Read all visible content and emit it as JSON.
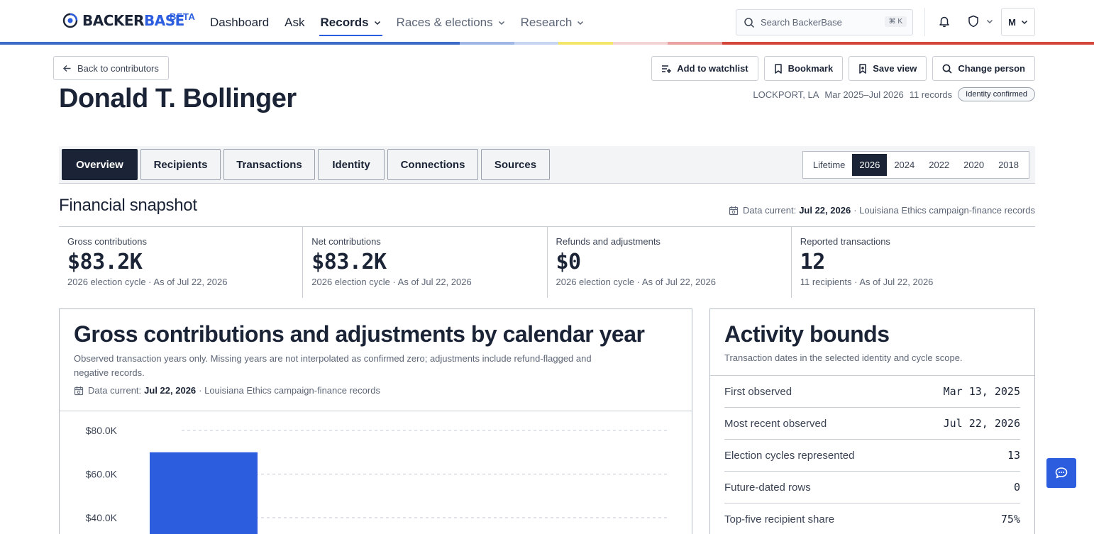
{
  "nav": {
    "logo_part1": "BACKER",
    "logo_part2": "BASE",
    "beta": "BETA",
    "links": [
      {
        "label": "Dashboard"
      },
      {
        "label": "Ask"
      },
      {
        "label": "Records"
      },
      {
        "label": "Races & elections"
      },
      {
        "label": "Research"
      }
    ],
    "search_placeholder": "Search BackerBase",
    "search_shortcut": "⌘ K",
    "user_initial": "M",
    "stripe_colors": [
      "#3b6cc7",
      "#9fb6e6",
      "#c6d6f2",
      "#f4e66a",
      "#f3d4d4",
      "#e8a2a2",
      "#d4453a"
    ]
  },
  "header": {
    "back_label": "Back to contributors",
    "name": "Donald T. Bollinger",
    "actions": {
      "watchlist": "Add to watchlist",
      "bookmark": "Bookmark",
      "save_view": "Save view",
      "change_person": "Change person"
    },
    "location": "LOCKPORT, LA",
    "date_range": "Mar 2025–Jul 2026",
    "record_count": "11 records",
    "identity_badge": "Identity confirmed"
  },
  "tabs": [
    "Overview",
    "Recipients",
    "Transactions",
    "Identity",
    "Connections",
    "Sources"
  ],
  "active_tab": "Overview",
  "cycles": [
    "Lifetime",
    "2026",
    "2024",
    "2022",
    "2020",
    "2018"
  ],
  "active_cycle": "2026",
  "snapshot": {
    "title": "Financial snapshot",
    "data_current_label": "Data current:",
    "data_current_date": "Jul 22, 2026",
    "data_current_source": "· Louisiana Ethics campaign-finance records",
    "stats": [
      {
        "label": "Gross contributions",
        "value": "$83.2K",
        "sub": "2026 election cycle · As of Jul 22, 2026"
      },
      {
        "label": "Net contributions",
        "value": "$83.2K",
        "sub": "2026 election cycle · As of Jul 22, 2026"
      },
      {
        "label": "Refunds and adjustments",
        "value": "$0",
        "sub": "2026 election cycle · As of Jul 22, 2026"
      },
      {
        "label": "Reported transactions",
        "value": "12",
        "sub": "11 recipients · As of Jul 22, 2026"
      }
    ]
  },
  "chart": {
    "title": "Gross contributions and adjustments by calendar year",
    "description": "Observed transaction years only. Missing years are not interpolated as confirmed zero; adjustments include refund-flagged and negative records.",
    "data_current_label": "Data current:",
    "data_current_date": "Jul 22, 2026",
    "data_current_source": "· Louisiana Ethics campaign-finance records",
    "bar_color": "#2b5dde"
  },
  "chart_data": {
    "type": "bar",
    "title": "Gross contributions and adjustments by calendar year",
    "y_ticks": [
      "$80.0K",
      "$60.0K",
      "$40.0K"
    ],
    "y_tick_values": [
      80000,
      60000,
      40000
    ],
    "ylim": [
      0,
      85000
    ],
    "values": [
      70000
    ],
    "grid": true
  },
  "activity": {
    "title": "Activity bounds",
    "description": "Transaction dates in the selected identity and cycle scope.",
    "rows": [
      {
        "label": "First observed",
        "value": "Mar 13, 2025"
      },
      {
        "label": "Most recent observed",
        "value": "Jul 22, 2026"
      },
      {
        "label": "Election cycles represented",
        "value": "13"
      },
      {
        "label": "Future-dated rows",
        "value": "0"
      },
      {
        "label": "Top-five recipient share",
        "value": "75%"
      }
    ]
  }
}
